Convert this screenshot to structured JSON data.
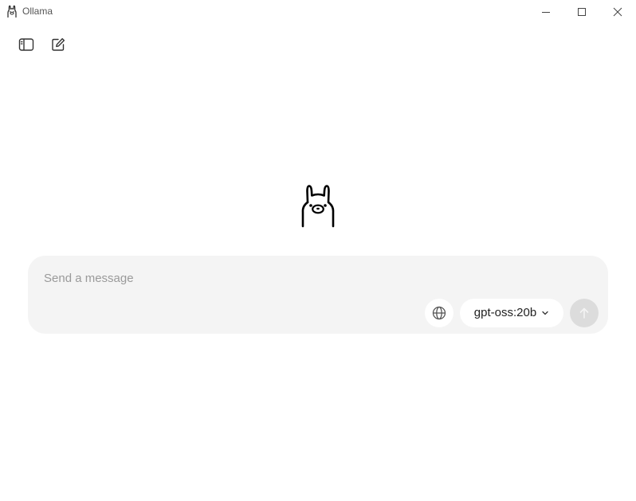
{
  "window": {
    "title": "Ollama",
    "controls": {
      "minimize_icon": "minimize-icon",
      "maximize_icon": "maximize-icon",
      "close_icon": "close-icon"
    }
  },
  "toolbar": {
    "sidebar_toggle_icon": "sidebar-icon",
    "new_chat_icon": "new-chat-icon"
  },
  "logo": {
    "icon": "ollama-llama-icon"
  },
  "composer": {
    "value": "",
    "placeholder": "Send a message",
    "web_search_icon": "globe-icon",
    "model": {
      "selected": "gpt-oss:20b",
      "dropdown_icon": "chevron-down-icon"
    },
    "send_icon": "arrow-up-icon",
    "send_disabled": true
  },
  "colors": {
    "background": "#ffffff",
    "composer_background": "#f4f4f4",
    "send_disabled_background": "#dcdcdc",
    "placeholder_text": "#9a9a9a"
  }
}
